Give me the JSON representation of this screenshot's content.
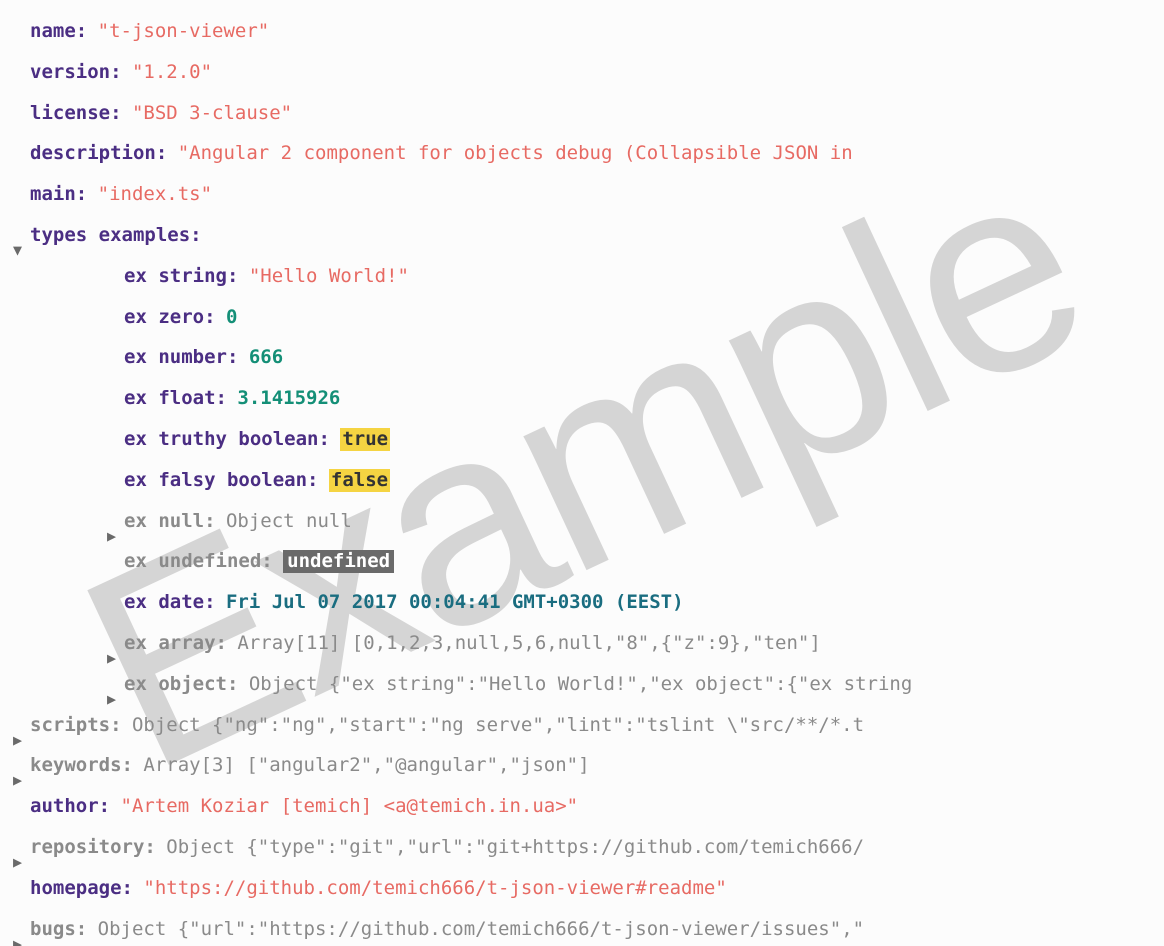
{
  "watermark": "Example",
  "root": {
    "name": {
      "key": "name",
      "value": "\"t-json-viewer\""
    },
    "version": {
      "key": "version",
      "value": "\"1.2.0\""
    },
    "license": {
      "key": "license",
      "value": "\"BSD 3-clause\""
    },
    "description": {
      "key": "description",
      "value": "\"Angular 2 component for objects debug (Collapsible JSON in"
    },
    "main": {
      "key": "main",
      "value": "\"index.ts\""
    },
    "types": {
      "key": "types examples"
    },
    "scripts": {
      "key": "scripts",
      "preview": "Object {\"ng\":\"ng\",\"start\":\"ng serve\",\"lint\":\"tslint \\\"src/**/*.t"
    },
    "keywords": {
      "key": "keywords",
      "preview": "Array[3] [\"angular2\",\"@angular\",\"json\"]"
    },
    "author": {
      "key": "author",
      "value": "\"Artem Koziar [temich] <a@temich.in.ua>\""
    },
    "repository": {
      "key": "repository",
      "preview": "Object {\"type\":\"git\",\"url\":\"git+https://github.com/temich666/"
    },
    "homepage": {
      "key": "homepage",
      "value": "\"https://github.com/temich666/t-json-viewer#readme\""
    },
    "bugs": {
      "key": "bugs",
      "preview": "Object {\"url\":\"https://github.com/temich666/t-json-viewer/issues\",\""
    }
  },
  "types_children": {
    "ex_string": {
      "key": "ex string",
      "value": "\"Hello World!\""
    },
    "ex_zero": {
      "key": "ex zero",
      "value": "0"
    },
    "ex_number": {
      "key": "ex number",
      "value": "666"
    },
    "ex_float": {
      "key": "ex float",
      "value": "3.1415926"
    },
    "ex_truthy": {
      "key": "ex truthy boolean",
      "value": "true"
    },
    "ex_falsy": {
      "key": "ex falsy boolean",
      "value": "false"
    },
    "ex_null": {
      "key": "ex null",
      "preview": "Object null"
    },
    "ex_undef": {
      "key": "ex undefined",
      "value": "undefined"
    },
    "ex_date": {
      "key": "ex date",
      "value": "Fri Jul 07 2017 00:04:41 GMT+0300 (EEST)"
    },
    "ex_array": {
      "key": "ex array",
      "preview": "Array[11] [0,1,2,3,null,5,6,null,\"8\",{\"z\":9},\"ten\"]"
    },
    "ex_object": {
      "key": "ex object",
      "preview": "Object {\"ex string\":\"Hello World!\",\"ex object\":{\"ex string"
    }
  }
}
